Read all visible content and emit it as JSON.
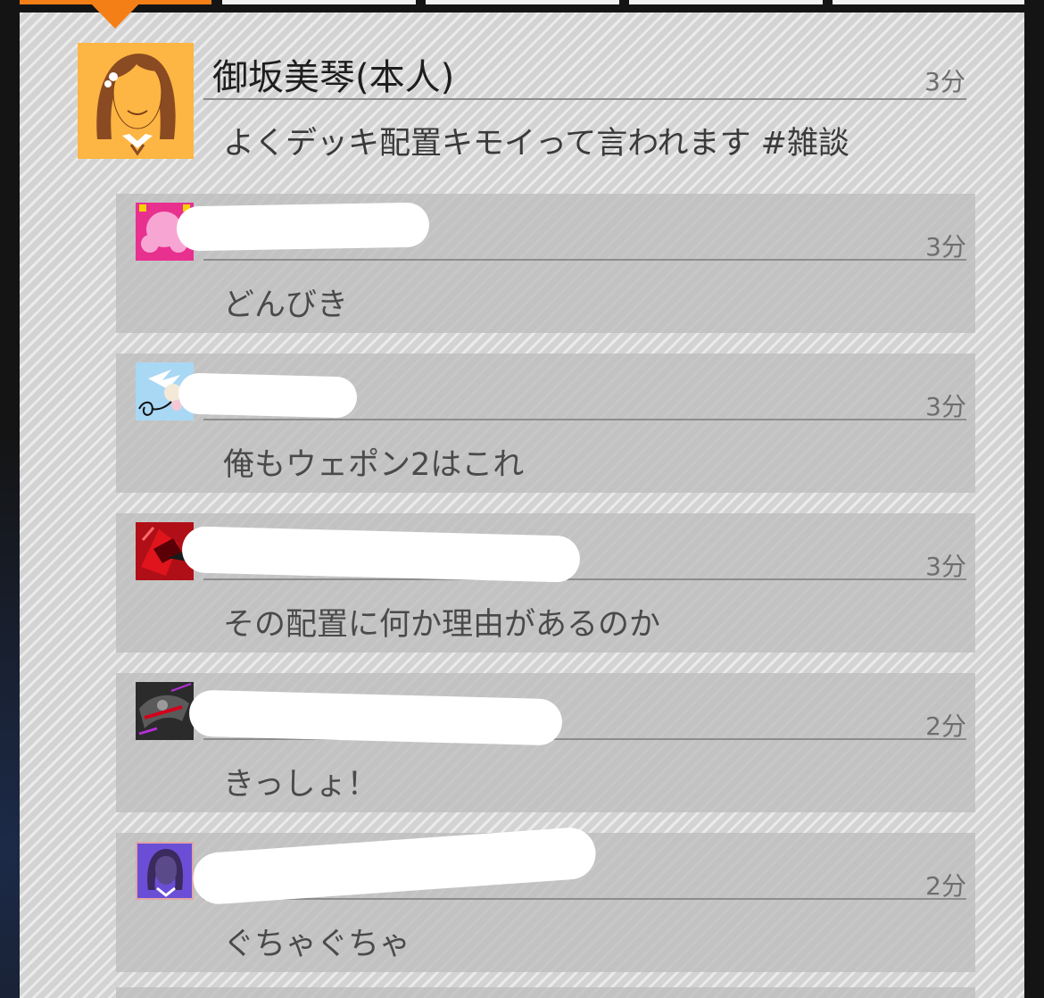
{
  "tabs": [
    {
      "label": "",
      "active": true
    },
    {
      "label": "",
      "active": false
    },
    {
      "label": "",
      "active": false
    },
    {
      "label": "",
      "active": false
    },
    {
      "label": "",
      "active": false
    }
  ],
  "post": {
    "author": "御坂美琴(本人)",
    "time": "3分",
    "message": "よくデッキ配置キモイって言われます #雑談",
    "avatar_icon": "orange-haired-girl-avatar-icon",
    "avatar_color": "#fdb543"
  },
  "replies": [
    {
      "time": "3分",
      "message": "どんびき",
      "avatar_icon": "pink-haired-character-avatar-icon",
      "avatar_color": "#e8308f"
    },
    {
      "time": "3分",
      "message": "俺もウェポン2はこれ",
      "avatar_icon": "white-winged-character-avatar-icon",
      "avatar_color": "#a9d8f5"
    },
    {
      "time": "3分",
      "message": "その配置に何か理由があるのか",
      "avatar_icon": "red-mecha-avatar-icon",
      "avatar_color": "#c4121a"
    },
    {
      "time": "2分",
      "message": "きっしょ！",
      "avatar_icon": "dark-mecha-avatar-icon",
      "avatar_color": "#2b2b2b"
    },
    {
      "time": "2分",
      "message": "ぐちゃぐちゃ",
      "avatar_icon": "purple-haired-character-avatar-icon",
      "avatar_color": "#6a4fd6"
    }
  ]
}
